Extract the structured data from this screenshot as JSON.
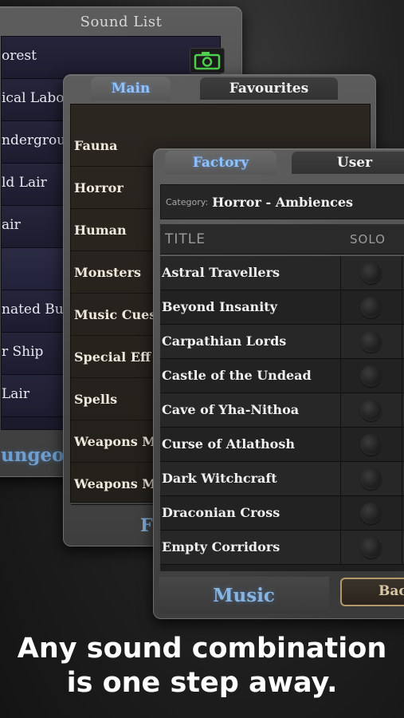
{
  "sound_list_panel": {
    "title": "Sound List",
    "items": [
      "orest",
      "ical Labo",
      "ndergrou",
      "ld Lair",
      "air",
      "",
      "nated Bu",
      "r Ship",
      "Lair"
    ],
    "footer_text": "ungeon"
  },
  "library_panel": {
    "tabs": [
      "Main",
      "Favourites"
    ],
    "active_tab": "Main",
    "categories": [
      "Fauna",
      "Horror",
      "Human",
      "Monsters",
      "Music Cues",
      "Special Eff",
      "Spells",
      "Weapons M",
      "Weapons M"
    ],
    "footer_text": "F"
  },
  "sounds_panel": {
    "tabs": [
      "Factory",
      "User"
    ],
    "active_tab": "Factory",
    "category_label": "Category:",
    "category_value": "Horror - Ambiences",
    "columns": {
      "title": "TITLE",
      "solo": "SOLO"
    },
    "rows": [
      "Astral Travellers",
      "Beyond Insanity",
      "Carpathian Lords",
      "Castle of the Undead",
      "Cave of Yha-Nithoa",
      "Curse of Atlathosh",
      "Dark Witchcraft",
      "Draconian Cross",
      "Empty Corridors"
    ],
    "music_label": "Music",
    "back_label": "Back"
  },
  "caption": {
    "line1": "Any sound combination",
    "line2": "is one step away."
  },
  "colors": {
    "accent": "#87b5e3",
    "panel": "#4a4a4a",
    "list_bg": "#1f1f1f"
  },
  "icons": [
    "camera-icon"
  ]
}
